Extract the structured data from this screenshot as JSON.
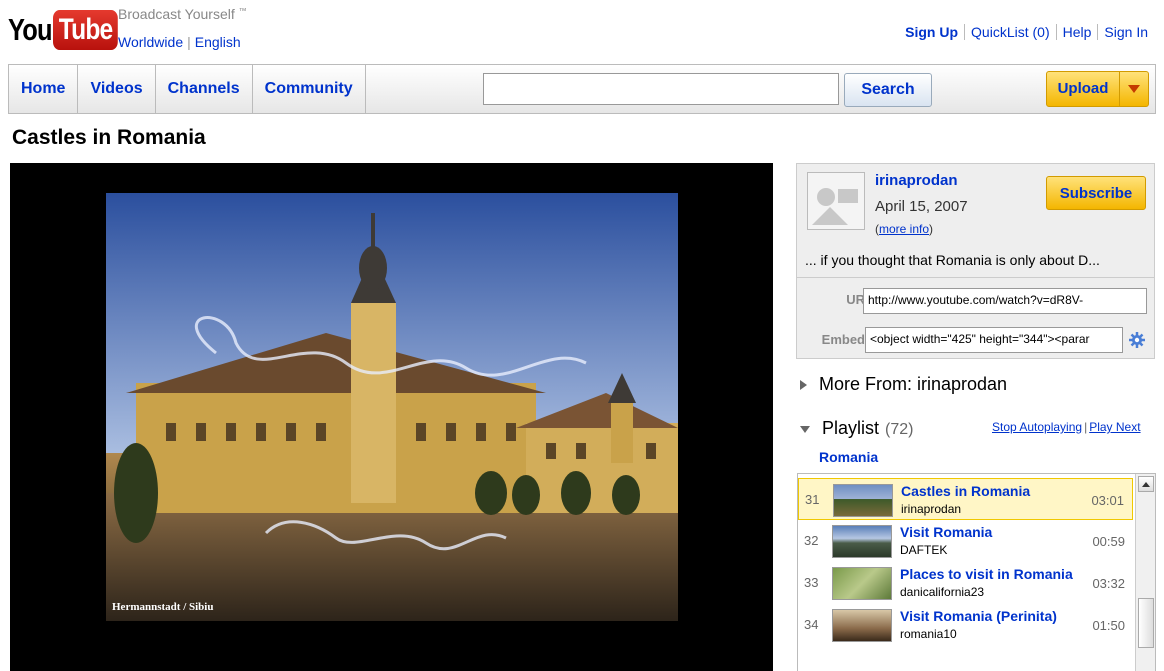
{
  "header": {
    "logo_you": "You",
    "logo_tube": "Tube",
    "tagline": "Broadcast Yourself",
    "tagline_tm": "™",
    "locale_region": "Worldwide",
    "locale_language": "English",
    "top_links": [
      "Sign Up",
      "QuickList (0)",
      "Help",
      "Sign In"
    ]
  },
  "nav": {
    "tabs": [
      "Home",
      "Videos",
      "Channels",
      "Community"
    ],
    "search_value": "",
    "search_label": "Search",
    "upload_label": "Upload"
  },
  "video": {
    "title": "Castles in Romania",
    "frame_caption": "Hermannstadt / Sibiu"
  },
  "info": {
    "uploader": "irinaprodan",
    "date": "April 15, 2007",
    "more_info_open": "(",
    "more_info": "more info",
    "more_info_close": ")",
    "subscribe_label": "Subscribe",
    "description": "... if you thought that Romania is only about D...",
    "url_label": "URL",
    "url_value": "http://www.youtube.com/watch?v=dR8V-",
    "embed_label": "Embed",
    "embed_value": "<object width=\"425\" height=\"344\"><parar"
  },
  "more_from": {
    "label": "More From: irinaprodan"
  },
  "playlist": {
    "label": "Playlist",
    "count": "(72)",
    "stop_autoplay": "Stop Autoplaying",
    "play_next": "Play Next",
    "name": "Romania",
    "items": [
      {
        "index": "31",
        "title": "Castles in Romania",
        "user": "irinaprodan",
        "duration": "03:01",
        "current": true
      },
      {
        "index": "32",
        "title": "Visit Romania",
        "user": "DAFTEK",
        "duration": "00:59",
        "current": false
      },
      {
        "index": "33",
        "title": "Places to visit in Romania",
        "user": "danicalifornia23",
        "duration": "03:32",
        "current": false
      },
      {
        "index": "34",
        "title": "Visit Romania (Perinita)",
        "user": "romania10",
        "duration": "01:50",
        "current": false
      }
    ]
  },
  "colors": {
    "link_blue": "#0033cc",
    "upload_yellow": "#f4b600",
    "current_row": "#fff6c6"
  }
}
